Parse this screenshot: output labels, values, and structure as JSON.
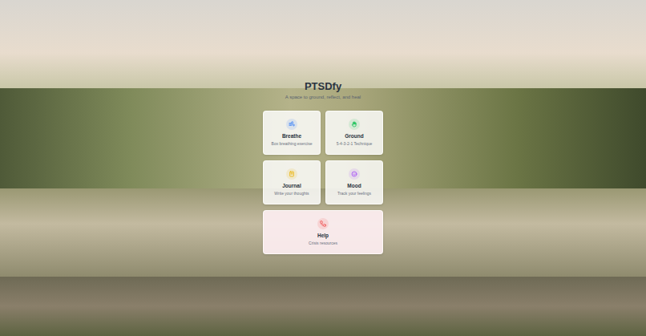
{
  "app": {
    "title": "PTSDfy",
    "subtitle": "A space to ground, reflect, and heal"
  },
  "cards": [
    {
      "label": "Breathe",
      "description": "Box breathing exercise",
      "color": "#3b82f6",
      "kind": "tool",
      "icon": "wind"
    },
    {
      "label": "Ground",
      "description": "5-4-3-2-1 Technique",
      "color": "#22c55e",
      "kind": "tool",
      "icon": "hand"
    },
    {
      "label": "Journal",
      "description": "Write your thoughts",
      "color": "#eab308",
      "kind": "tool",
      "icon": "book"
    },
    {
      "label": "Mood",
      "description": "Track your feelings",
      "color": "#a855f7",
      "kind": "tool",
      "icon": "smile"
    },
    {
      "label": "Help",
      "description": "Crisis resources",
      "color": "#ef4444",
      "kind": "crisis",
      "icon": "phone"
    }
  ]
}
